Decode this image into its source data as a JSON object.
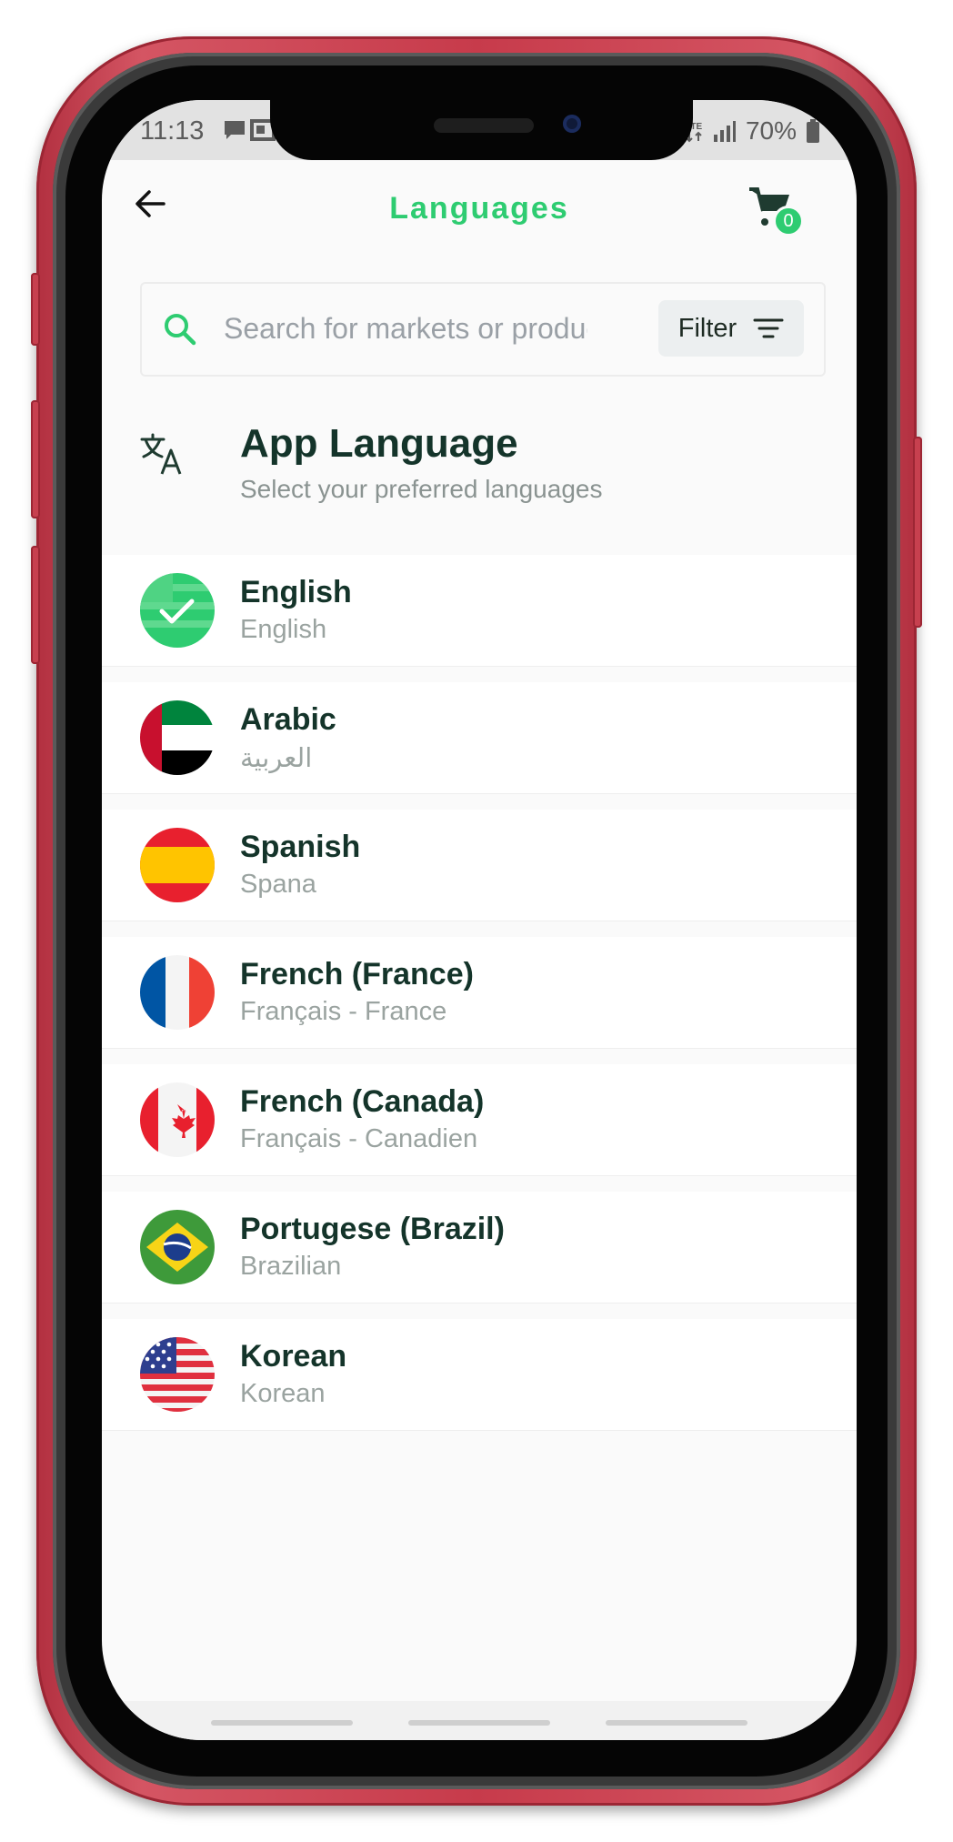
{
  "status_bar": {
    "time": "11:13",
    "battery": "70%"
  },
  "header": {
    "title": "Languages",
    "cart_count": "0"
  },
  "search": {
    "placeholder": "Search for markets or products",
    "value": "",
    "filter_label": "Filter"
  },
  "section": {
    "title": "App Language",
    "subtitle": "Select your preferred languages"
  },
  "languages": [
    {
      "name": "English",
      "native": "English",
      "selected": true
    },
    {
      "name": "Arabic",
      "native": "العربية",
      "selected": false
    },
    {
      "name": "Spanish",
      "native": "Spana",
      "selected": false
    },
    {
      "name": "French (France)",
      "native": "Français - France",
      "selected": false
    },
    {
      "name": "French (Canada)",
      "native": "Français - Canadien",
      "selected": false
    },
    {
      "name": "Portugese (Brazil)",
      "native": "Brazilian",
      "selected": false
    },
    {
      "name": "Korean",
      "native": "Korean",
      "selected": false
    }
  ],
  "colors": {
    "accent": "#2ecc71",
    "text_dark": "#14342a",
    "phone_frame": "#c7404f"
  }
}
